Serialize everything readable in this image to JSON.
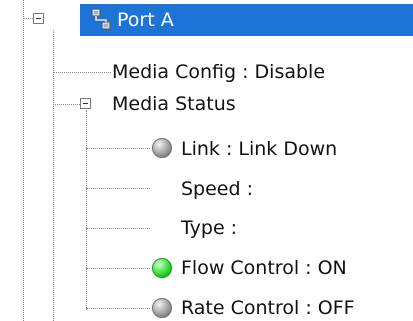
{
  "tree": {
    "root": {
      "label": "Port A",
      "selected": true,
      "selection_color": "#1e74d6",
      "icon": "network-port-icon"
    },
    "media_config": {
      "label": "Media Config : Disable"
    },
    "media_status": {
      "label": "Media Status",
      "children": [
        {
          "label": "Link : Link Down",
          "status": "off",
          "icon": "gray-status-led-icon"
        },
        {
          "label": "Speed :"
        },
        {
          "label": "Type :"
        },
        {
          "label": "Flow Control : ON",
          "status": "on",
          "icon": "green-status-led-icon"
        },
        {
          "label": "Rate Control : OFF",
          "status": "off",
          "icon": "gray-status-led-icon"
        }
      ]
    }
  },
  "colors": {
    "tree_line": "#8a8a8a",
    "led_on": "#23c423",
    "led_off": "#8a8a8a",
    "text": "#111111",
    "selected_text": "#ffffff"
  }
}
